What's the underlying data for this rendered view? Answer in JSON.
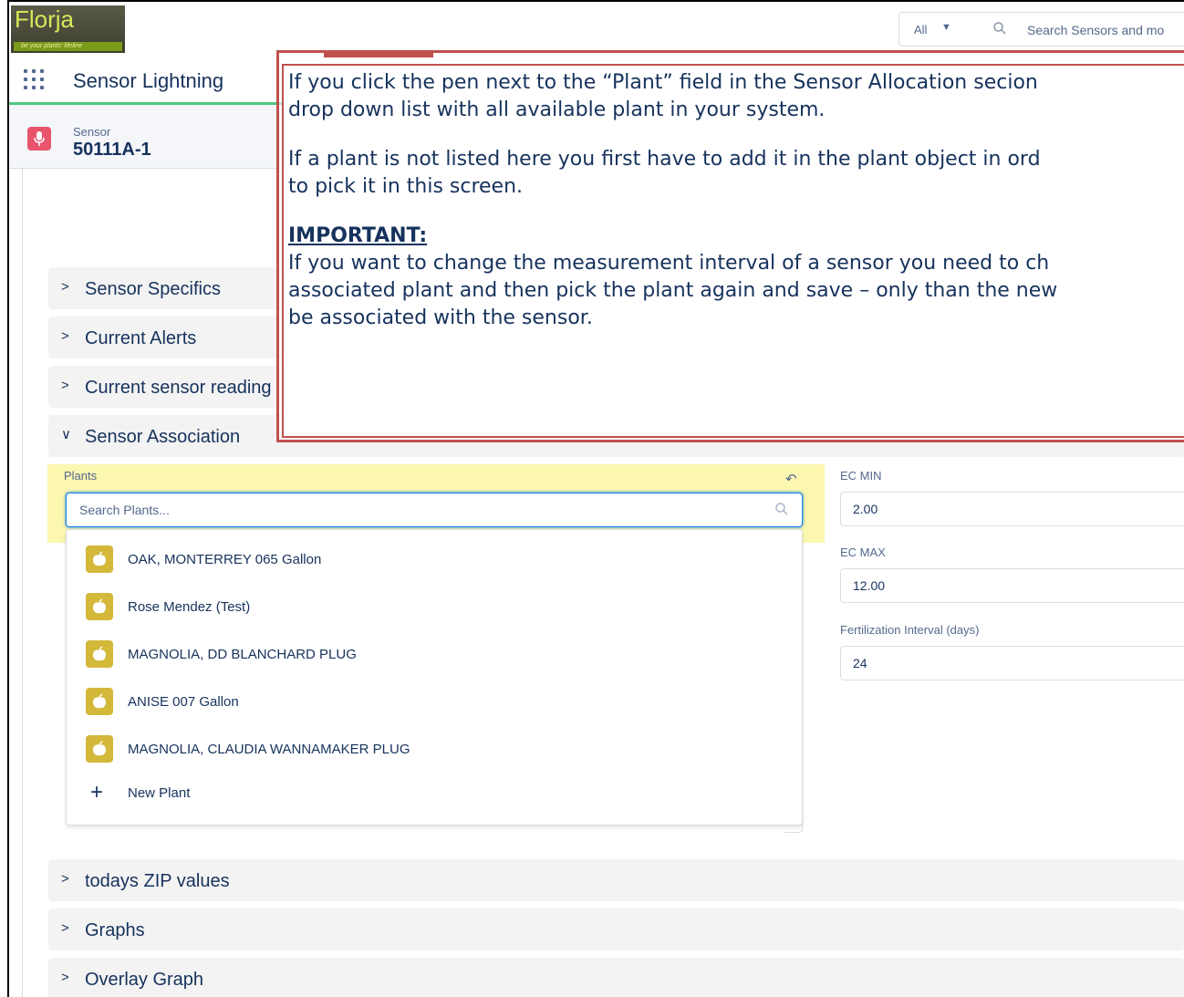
{
  "logo": {
    "text": "Florja",
    "tagline": "be your plants' lifeline"
  },
  "global_search": {
    "scope": "All",
    "placeholder": "Search Sensors and mo"
  },
  "app": {
    "name": "Sensor Lightning"
  },
  "record": {
    "type": "Sensor",
    "name": "50111A-1"
  },
  "sections": {
    "sensor_specifics": "Sensor Specifics",
    "current_alerts": "Current Alerts",
    "current_sensor_reading": "Current sensor reading",
    "sensor_association": "Sensor Association",
    "todays_zip_values": "todays ZIP values",
    "graphs": "Graphs",
    "overlay_graph": "Overlay Graph"
  },
  "lookup": {
    "label": "Plants",
    "placeholder": "Search Plants...",
    "results": [
      "OAK, MONTERREY 065 Gallon",
      "Rose Mendez (Test)",
      "MAGNOLIA, DD BLANCHARD PLUG",
      "ANISE 007 Gallon",
      "MAGNOLIA, CLAUDIA WANNAMAKER PLUG"
    ],
    "new_label": "New Plant"
  },
  "fields": {
    "ec_min": {
      "label": "EC MIN",
      "value": "2.00"
    },
    "ec_max": {
      "label": "EC MAX",
      "value": "12.00"
    },
    "fert_interval": {
      "label": "Fertilization Interval (days)",
      "value": "24"
    }
  },
  "callout": {
    "line1": "If you click the pen next to the “Plant” field in the Sensor Allocation secion",
    "line2": "drop down list with all available plant in your system.",
    "line3": "If a plant is not listed here you first have to add it in the plant object in ord",
    "line4": "to pick it in this screen.",
    "heading": "IMPORTANT:",
    "line5": "If you want to change the measurement interval of a sensor you need to ch",
    "line6": "associated plant and then pick the plant again and save – only than the new",
    "line7": "be associated with the sensor."
  },
  "colors": {
    "accent_red": "#c0504d",
    "highlight": "#fbf6b0",
    "sensor_icon": "#e8546b",
    "plant_icon": "#d4b83a",
    "nav_green": "#4bca81"
  }
}
